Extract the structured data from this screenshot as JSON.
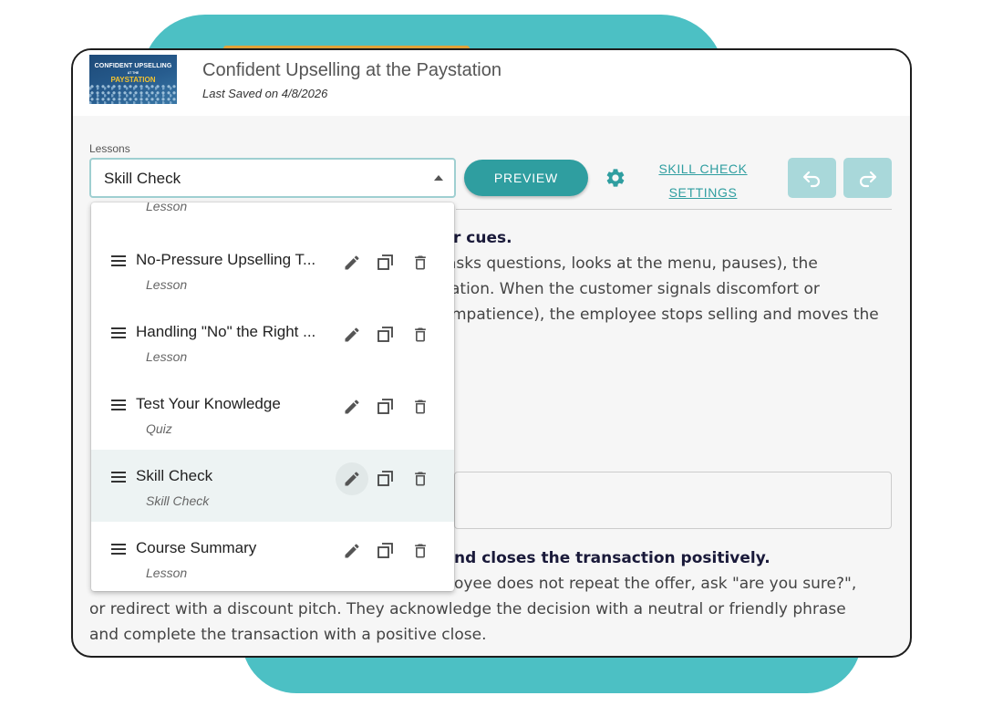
{
  "course": {
    "title": "Confident Upselling at the Paystation",
    "last_saved": "Last Saved on 4/8/2026",
    "thumbnail": {
      "line1": "CONFIDENT UPSELLING",
      "line2": "AT THE",
      "line3": "PAYSTATION"
    }
  },
  "toolbar": {
    "lessons_label": "Lessons",
    "selected_lesson": "Skill Check",
    "preview_label": "PREVIEW",
    "settings_link_line1": "SKILL CHECK",
    "settings_link_line2": "SETTINGS",
    "settings_icon": "gear-icon",
    "undo_icon": "undo-icon",
    "redo_icon": "redo-icon"
  },
  "dropdown": {
    "partial_item_type": "Lesson",
    "items": [
      {
        "name": "No-Pressure Upselling T...",
        "type": "Lesson"
      },
      {
        "name": "Handling \"No\" the Right ...",
        "type": "Lesson"
      },
      {
        "name": "Test Your Knowledge",
        "type": "Quiz"
      },
      {
        "name": "Skill Check",
        "type": "Skill Check"
      },
      {
        "name": "Course Summary",
        "type": "Lesson"
      }
    ]
  },
  "content": {
    "criterion1_heading_tail": "r cues.",
    "criterion1_line1": "asks questions, looks at the menu, pauses), the",
    "criterion1_line2": "ation. When the customer signals discomfort or",
    "criterion1_line3": "mpatience), the employee stops selling and moves the",
    "criterion2_heading_tail": "nd closes the transaction positively.",
    "criterion2_line1": "oyee does not repeat the offer, ask \"are you sure?\",",
    "criterion2_line2": "or redirect with a discount pitch. They acknowledge the decision with a neutral or friendly phrase",
    "criterion2_line3": "and complete the transaction with a positive close."
  },
  "colors": {
    "accent": "#2f9ea0",
    "background_blob": "#4cc0c4",
    "disabled_button": "#a9d8da",
    "selected_row": "#edf3f3"
  }
}
